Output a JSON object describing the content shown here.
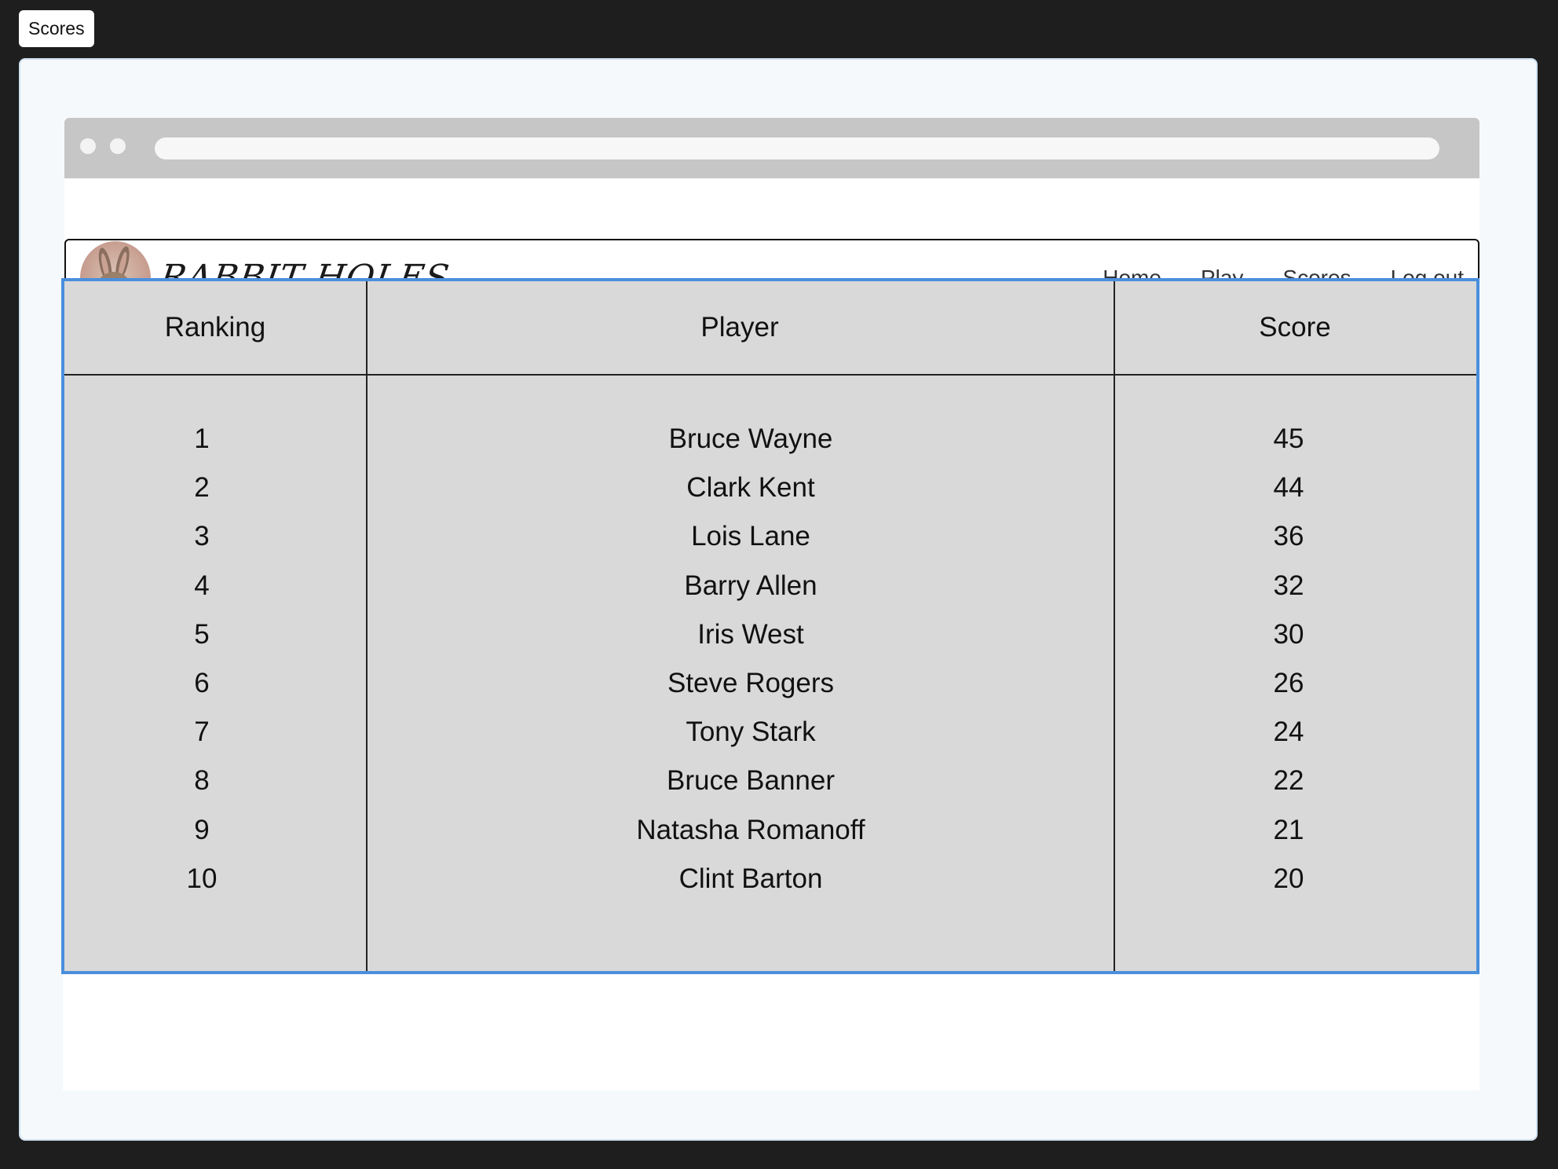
{
  "frame_label": "Scores",
  "brand": {
    "name": "RABBIT HOLES",
    "logo_icon": "rabbit-icon"
  },
  "nav": {
    "items": [
      {
        "label": "Home"
      },
      {
        "label": "Play"
      },
      {
        "label": "Scores"
      },
      {
        "label": "Log out"
      }
    ]
  },
  "table": {
    "headers": [
      "Ranking",
      "Player",
      "Score"
    ],
    "rows": [
      {
        "rank": "1",
        "player": "Bruce Wayne",
        "score": "45"
      },
      {
        "rank": "2",
        "player": "Clark Kent",
        "score": "44"
      },
      {
        "rank": "3",
        "player": "Lois Lane",
        "score": "36"
      },
      {
        "rank": "4",
        "player": "Barry Allen",
        "score": "32"
      },
      {
        "rank": "5",
        "player": "Iris West",
        "score": "30"
      },
      {
        "rank": "6",
        "player": "Steve Rogers",
        "score": "26"
      },
      {
        "rank": "7",
        "player": "Tony Stark",
        "score": "24"
      },
      {
        "rank": "8",
        "player": "Bruce Banner",
        "score": "22"
      },
      {
        "rank": "9",
        "player": "Natasha Romanoff",
        "score": "21"
      },
      {
        "rank": "10",
        "player": "Clint Barton",
        "score": "20"
      }
    ]
  },
  "colors": {
    "table_selection_border": "#4a8fdc",
    "table_background": "#d9d9d9",
    "browser_chrome": "#c6c6c6"
  }
}
